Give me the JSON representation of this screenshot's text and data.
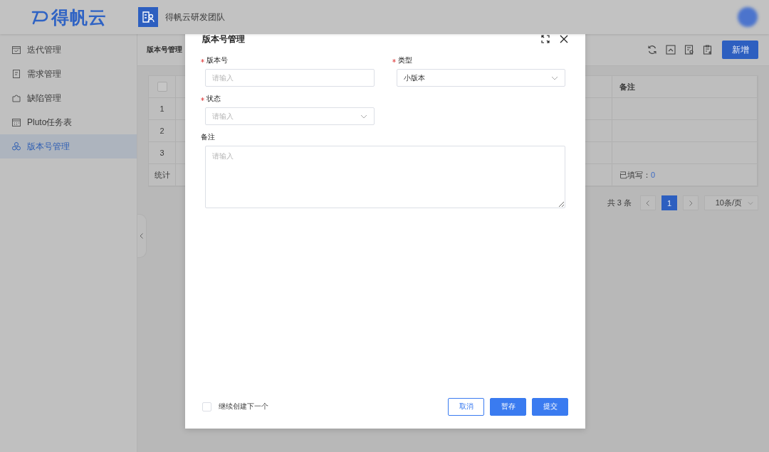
{
  "header": {
    "logo": "得帆云",
    "team": "得帆云研发团队"
  },
  "sidebar": {
    "items": [
      {
        "label": "迭代管理",
        "selected": false
      },
      {
        "label": "需求管理",
        "selected": false
      },
      {
        "label": "缺陷管理",
        "selected": false
      },
      {
        "label": "Pluto任务表",
        "selected": false
      },
      {
        "label": "版本号管理",
        "selected": true
      }
    ]
  },
  "page": {
    "title": "版本号管理",
    "new_button": "新增"
  },
  "table": {
    "select_all_checked": false,
    "last_column": "备注",
    "rows": [
      {
        "index": "1"
      },
      {
        "index": "2"
      },
      {
        "index": "3"
      }
    ],
    "summary": {
      "label": "统计",
      "filled_label": "已填写：",
      "filled_value": "0"
    }
  },
  "pagination": {
    "total": "共 3 条",
    "pages": [
      {
        "label": "1",
        "selected": true
      }
    ],
    "page_size": "10条/页"
  },
  "dialog": {
    "title": "版本号管理",
    "fields": [
      {
        "label": "版本号",
        "required": true,
        "kind": "input",
        "placeholder": "请输入"
      },
      {
        "label": "类型",
        "required": true,
        "kind": "select",
        "value": "小版本"
      },
      {
        "label": "状态",
        "required": true,
        "kind": "select",
        "placeholder": "请输入"
      },
      {
        "label": "备注",
        "required": false,
        "kind": "textarea",
        "placeholder": "请输入"
      }
    ],
    "continue": {
      "label": "继续创建下一个",
      "checked": false
    },
    "buttons": [
      {
        "label": "取消",
        "kind": "secondary"
      },
      {
        "label": "暂存",
        "kind": "primary"
      },
      {
        "label": "提交",
        "kind": "primary"
      }
    ]
  }
}
